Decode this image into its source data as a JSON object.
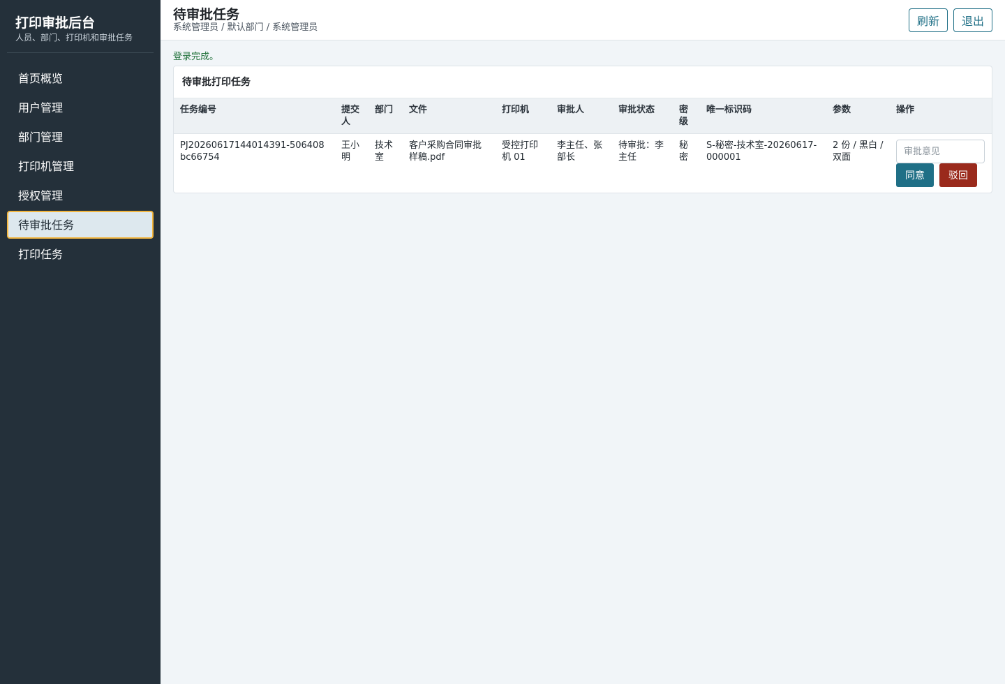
{
  "sidebar": {
    "title": "打印审批后台",
    "subtitle": "人员、部门、打印机和审批任务",
    "items": [
      {
        "label": "首页概览",
        "active": false
      },
      {
        "label": "用户管理",
        "active": false
      },
      {
        "label": "部门管理",
        "active": false
      },
      {
        "label": "打印机管理",
        "active": false
      },
      {
        "label": "授权管理",
        "active": false
      },
      {
        "label": "待审批任务",
        "active": true
      },
      {
        "label": "打印任务",
        "active": false
      }
    ]
  },
  "header": {
    "title": "待审批任务",
    "breadcrumb": "系统管理员 / 默认部门 / 系统管理员",
    "refresh_label": "刷新",
    "logout_label": "退出"
  },
  "status_message": "登录完成。",
  "panel": {
    "title": "待审批打印任务",
    "columns": [
      "任务编号",
      "提交人",
      "部门",
      "文件",
      "打印机",
      "审批人",
      "审批状态",
      "密级",
      "唯一标识码",
      "参数",
      "操作"
    ],
    "rows": [
      {
        "task_id": "PJ20260617144014391-506408bc66754",
        "submitter": "王小明",
        "department": "技术室",
        "file": "客户采购合同审批样稿.pdf",
        "printer": "受控打印机 01",
        "approvers": "李主任、张部长",
        "status": "待审批：李主任",
        "classification": "秘密",
        "unique_code": "S-秘密-技术室-20260617-000001",
        "params": "2 份 / 黑白 / 双面",
        "opinion_placeholder": "审批意见",
        "opinion_value": "",
        "approve_label": "同意",
        "reject_label": "驳回"
      }
    ]
  },
  "colors": {
    "sidebar_bg": "#24303a",
    "accent": "#1f6f86",
    "reject": "#9a2a1c",
    "active_border": "#f2b640",
    "success_text": "#23733d"
  }
}
